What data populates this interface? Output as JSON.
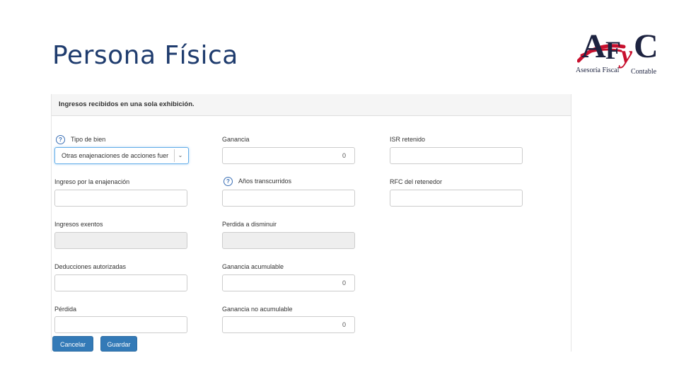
{
  "slide": {
    "title": "Persona Física"
  },
  "logo": {
    "letters": [
      "A",
      "F",
      "y",
      "C"
    ],
    "subtitle_left": "Asesoría Fiscal",
    "subtitle_right": "Contable",
    "brand_colors": {
      "navy": "#1d2340",
      "red": "#c8102e"
    }
  },
  "form": {
    "header": "Ingresos recibidos en una sola exhibición.",
    "fields": {
      "tipo_bien": {
        "label": "Tipo de bien",
        "value": "Otras enajenaciones de acciones fuer",
        "icon": "help-circle-icon"
      },
      "ganancia": {
        "label": "Ganancia",
        "value": "0"
      },
      "isr_retenido": {
        "label": "ISR retenido",
        "value": ""
      },
      "ingreso_enajenacion": {
        "label": "Ingreso por la enajenación",
        "value": ""
      },
      "anios_transcurridos": {
        "label": "Años transcurridos",
        "value": "",
        "icon": "help-circle-icon"
      },
      "rfc_retenedor": {
        "label": "RFC del retenedor",
        "value": ""
      },
      "ingresos_exentos": {
        "label": "Ingresos exentos",
        "value": ""
      },
      "perdida_disminuir": {
        "label": "Perdida a disminuir",
        "value": ""
      },
      "deducciones_autorizadas": {
        "label": "Deducciones autorizadas",
        "value": ""
      },
      "ganancia_acumulable": {
        "label": "Ganancia acumulable",
        "value": "0"
      },
      "perdida": {
        "label": "Pérdida",
        "value": ""
      },
      "ganancia_no_acumulable": {
        "label": "Ganancia no acumulable",
        "value": "0"
      }
    },
    "buttons": {
      "cancel": "Cancelar",
      "save": "Guardar"
    },
    "colors": {
      "primary": "#337ab7",
      "help_icon": "#3a6fb5",
      "disabled_bg": "#eeeeee"
    }
  }
}
